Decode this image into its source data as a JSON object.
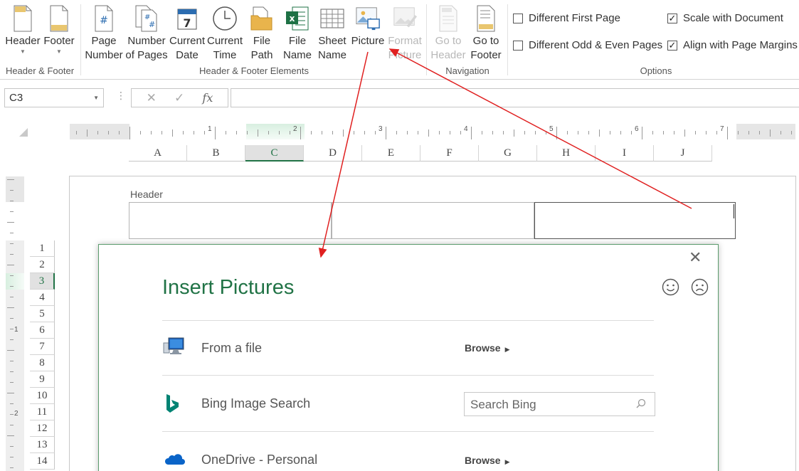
{
  "ribbon": {
    "header_footer_group": {
      "label": "Header & Footer",
      "header_btn": "Header",
      "footer_btn": "Footer"
    },
    "elements_group": {
      "label": "Header & Footer Elements",
      "page_number": [
        "Page",
        "Number"
      ],
      "number_of_pages": [
        "Number",
        "of Pages"
      ],
      "current_date": [
        "Current",
        "Date"
      ],
      "current_time": [
        "Current",
        "Time"
      ],
      "file_path": [
        "File",
        "Path"
      ],
      "file_name": [
        "File",
        "Name"
      ],
      "sheet_name": [
        "Sheet",
        "Name"
      ],
      "picture": "Picture",
      "format_picture": [
        "Format",
        "Picture"
      ]
    },
    "navigation_group": {
      "label": "Navigation",
      "go_to_header": [
        "Go to",
        "Header"
      ],
      "go_to_footer": [
        "Go to",
        "Footer"
      ]
    },
    "options_group": {
      "label": "Options",
      "different_first_page": "Different First Page",
      "different_first_page_checked": false,
      "different_odd_even": "Different Odd & Even Pages",
      "different_odd_even_checked": false,
      "scale_with_document": "Scale with Document",
      "scale_with_document_checked": true,
      "align_with_margins": "Align with Page Margins",
      "align_with_margins_checked": true
    },
    "icons": {
      "calendar_day": "7",
      "page_number_glyph": "#",
      "excel_glyph": "x"
    }
  },
  "formula_bar": {
    "name_box": "C3",
    "fx": "fx",
    "formula": ""
  },
  "sheet": {
    "columns": [
      "A",
      "B",
      "C",
      "D",
      "E",
      "F",
      "G",
      "H",
      "I",
      "J"
    ],
    "selected_column": "C",
    "rows": [
      "1",
      "2",
      "3",
      "4",
      "5",
      "6",
      "7",
      "8",
      "9",
      "10",
      "11",
      "12",
      "13",
      "14"
    ],
    "selected_row": "3",
    "ruler_numbers": [
      "1",
      "2",
      "3",
      "4",
      "5",
      "6",
      "7"
    ],
    "vruler_numbers": [
      "1",
      "2"
    ],
    "header_label": "Header"
  },
  "dialog": {
    "title": "Insert Pictures",
    "close": "✕",
    "sources": [
      {
        "label": "From a file",
        "action": "Browse"
      },
      {
        "label": "Bing Image Search",
        "placeholder": "Search Bing"
      },
      {
        "label": "OneDrive - Personal",
        "action": "Browse"
      }
    ]
  },
  "colors": {
    "excel_green": "#217346",
    "arrow_red": "#e02020",
    "bing_teal": "#008373",
    "onedrive_blue": "#0a64c8"
  }
}
